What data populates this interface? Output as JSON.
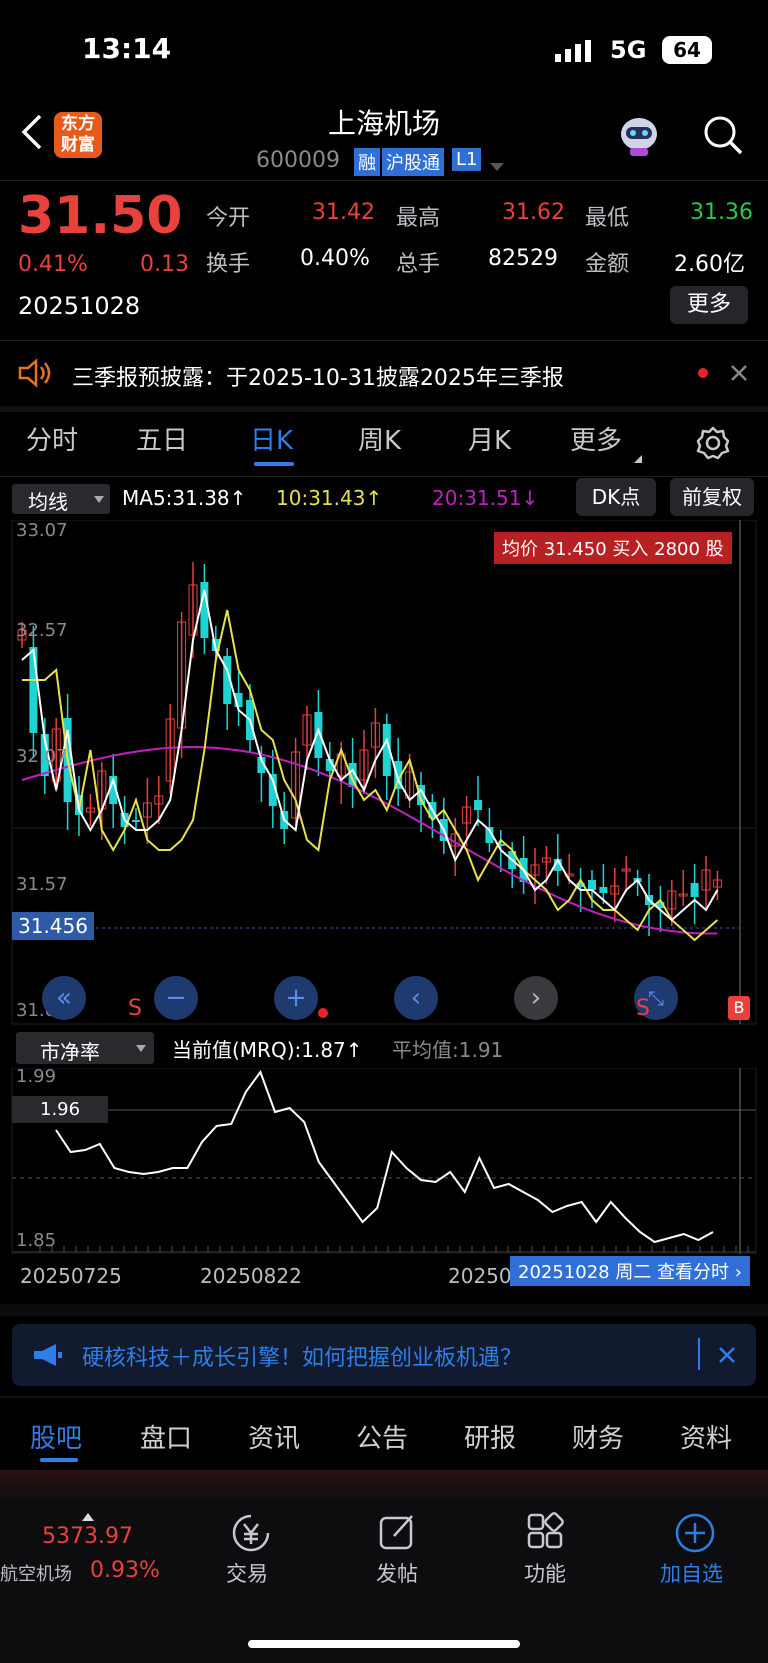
{
  "status_bar": {
    "time": "13:14",
    "network": "5G",
    "battery": "64"
  },
  "header": {
    "title": "上海机场",
    "code": "600009",
    "tags": [
      "融",
      "沪股通",
      "L1"
    ],
    "logo_text": "东方财富"
  },
  "quote": {
    "price": "31.50",
    "change_pct": "0.41%",
    "change_amt": "0.13",
    "date": "20251028",
    "open_label": "今开",
    "open": "31.42",
    "high_label": "最高",
    "high": "31.62",
    "low_label": "最低",
    "low": "31.36",
    "turnover_label": "换手",
    "turnover": "0.40%",
    "volume_label": "总手",
    "volume": "82529",
    "amount_label": "金额",
    "amount": "2.60亿",
    "more_label": "更多"
  },
  "notice": {
    "text": "三季报预披露：于2025-10-31披露2025年三季报"
  },
  "tabs": [
    "分时",
    "五日",
    "日K",
    "周K",
    "月K",
    "更多"
  ],
  "active_tab": "日K",
  "kline": {
    "indicator_select": "均线",
    "ma5": "MA5:31.38↑",
    "ma10": "10:31.43↑",
    "ma20": "20:31.51↓",
    "dk_label": "DK点",
    "adjust_label": "前复权",
    "avg_price_tag": "均价 31.450 买入 2800 股",
    "axis": [
      "33.07",
      "32.57",
      "32.07",
      "31.57",
      "31.07"
    ],
    "current_tag": "31.456",
    "marker_s": "S",
    "marker_b": "B"
  },
  "pb": {
    "select": "市净率",
    "current": "当前值(MRQ):1.87↑",
    "avg": "平均值:1.91",
    "axis_top": "1.99",
    "axis_bottom": "1.85",
    "tag": "1.96",
    "dates": [
      "20250725",
      "20250822",
      "20250"
    ],
    "date_tag": "20251028 周二 查看分时"
  },
  "banner": {
    "text": "硬核科技＋成长引擎！如何把握创业板机遇？"
  },
  "bottom_tabs": [
    "股吧",
    "盘口",
    "资讯",
    "公告",
    "研报",
    "财务",
    "资料"
  ],
  "index_ticker": {
    "value": "5373.97",
    "name": "航空机场",
    "pct": "0.93%"
  },
  "bottom_nav": [
    "交易",
    "发帖",
    "功能",
    "加自选"
  ],
  "colors": {
    "up": "#e8413e",
    "down": "#1fd3d3",
    "accent": "#2f7ee8",
    "ma5": "#ffffff",
    "ma10": "#e8e24a",
    "ma20": "#c21fc2"
  }
}
